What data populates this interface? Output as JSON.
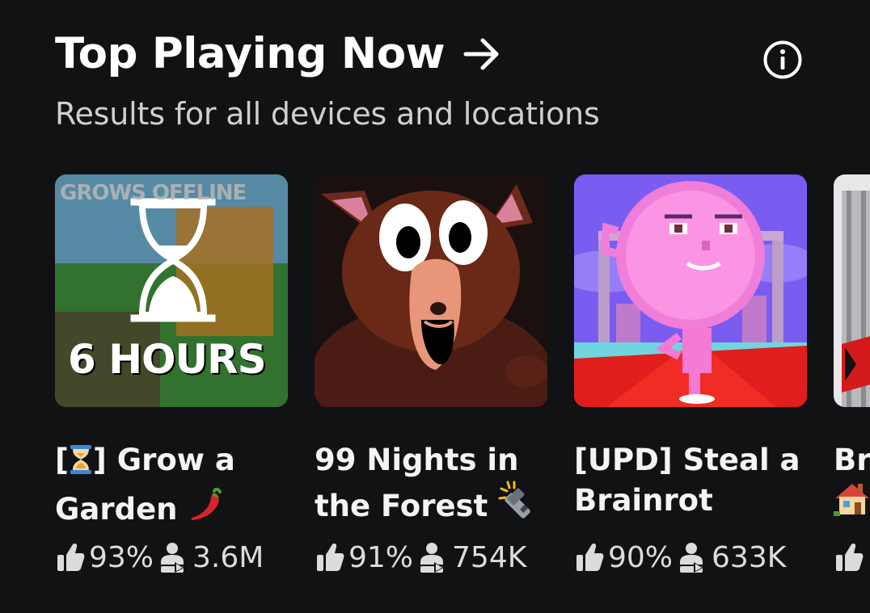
{
  "header": {
    "title": "Top Playing Now",
    "subtitle": "Results for all devices and locations",
    "arrow_icon": "arrow-right-icon",
    "info_icon": "info-circle-icon"
  },
  "cards": [
    {
      "name_prefix": "[",
      "name_suffix": "] Grow a",
      "name_line2": "Garden",
      "icons": [
        "hourglass-emoji",
        "chili-pepper-emoji"
      ],
      "thumb_text_top": "GROWS OFFLINE",
      "thumb_text_bottom": "6 HOURS",
      "rating": "93%",
      "players": "3.6M"
    },
    {
      "name_line1": "99 Nights in",
      "name_line2": "the Forest",
      "icons": [
        "flashlight-emoji"
      ],
      "rating": "91%",
      "players": "754K"
    },
    {
      "name_line1": "[UPD] Steal a",
      "name_line2": "Brainrot",
      "rating": "90%",
      "players": "633K"
    },
    {
      "name_line1": "Br",
      "icons": [
        "house-emoji"
      ]
    }
  ],
  "colors": {
    "background": "#111214",
    "text": "#f4f4f4",
    "muted": "#cfcfd2"
  }
}
